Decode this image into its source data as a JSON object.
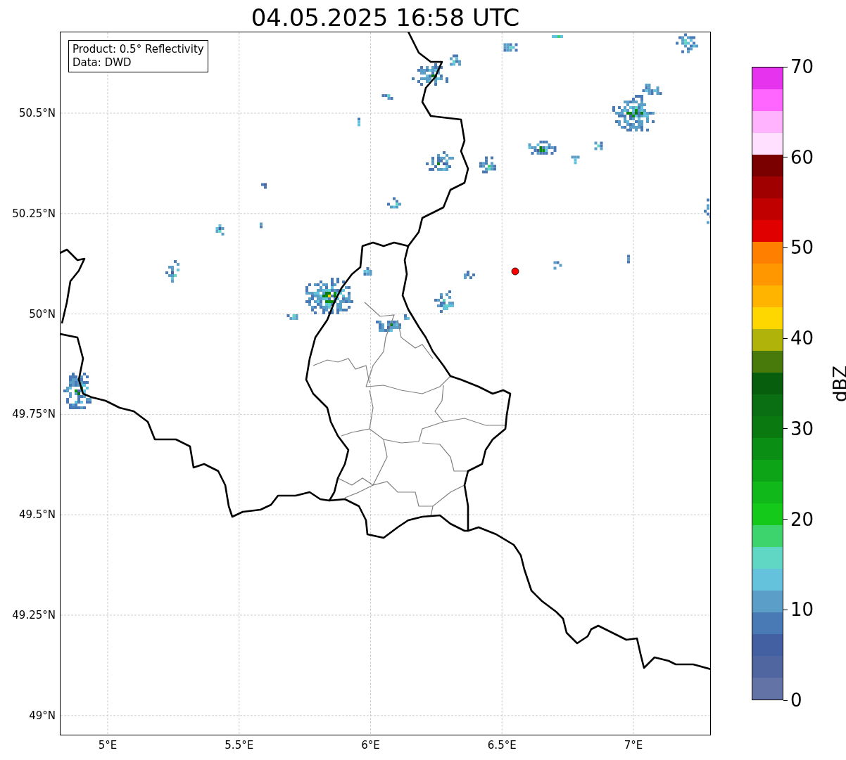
{
  "title": "04.05.2025 16:58 UTC",
  "info_box": [
    "Product: 0.5° Reflectivity",
    "Data: DWD"
  ],
  "map": {
    "x_ticks": [
      "5°E",
      "5.5°E",
      "6°E",
      "6.5°E",
      "7°E"
    ],
    "y_ticks": [
      "50.5°N",
      "50.25°N",
      "50°N",
      "49.75°N",
      "49.5°N",
      "49.25°N",
      "49°N"
    ]
  },
  "colorbar": {
    "label": "dBZ",
    "ticks": [
      "70",
      "60",
      "50",
      "40",
      "30",
      "20",
      "10",
      "0"
    ],
    "bands": [
      {
        "color": "#e633ee"
      },
      {
        "color": "#ff66ff"
      },
      {
        "color": "#ffb3ff"
      },
      {
        "color": "#ffe0ff"
      },
      {
        "color": "#7a0000"
      },
      {
        "color": "#a00000"
      },
      {
        "color": "#c00000"
      },
      {
        "color": "#e00000"
      },
      {
        "color": "#ff7f00"
      },
      {
        "color": "#ff9800"
      },
      {
        "color": "#ffb400"
      },
      {
        "color": "#ffd700"
      },
      {
        "color": "#b0b30a"
      },
      {
        "color": "#487a0b"
      },
      {
        "color": "#075e0c"
      },
      {
        "color": "#0a6e12"
      },
      {
        "color": "#0a7a10"
      },
      {
        "color": "#0b8e14"
      },
      {
        "color": "#0ea418"
      },
      {
        "color": "#10b81a"
      },
      {
        "color": "#14c91a"
      },
      {
        "color": "#3dd46e"
      },
      {
        "color": "#5fd7c4"
      },
      {
        "color": "#64c2dc"
      },
      {
        "color": "#5b9ec8"
      },
      {
        "color": "#4a7ab5"
      },
      {
        "color": "#4360a3"
      },
      {
        "color": "#5066a0"
      },
      {
        "color": "#6473a6"
      }
    ]
  }
}
